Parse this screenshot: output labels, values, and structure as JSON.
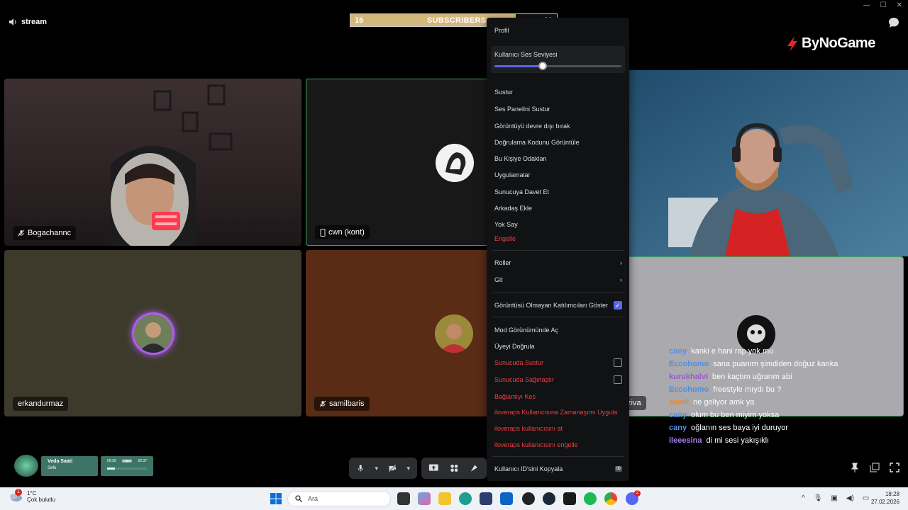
{
  "window": {
    "controls": [
      "—",
      "☐",
      "✕"
    ],
    "title": "stream"
  },
  "subscriber_bar": {
    "current": "16",
    "label": "SUBSCRIBERS",
    "goal": "20",
    "progress_fraction": 0.8
  },
  "logo": {
    "text": "ByNoGame"
  },
  "tiles": [
    {
      "name": "Bogachannc",
      "icon": "mic-muted-icon"
    },
    {
      "name": "cwn (kont)",
      "icon": "phone-icon"
    },
    {
      "name": "erkandurmaz",
      "icon": ""
    },
    {
      "name": "samilbaris",
      "icon": "mic-muted-icon"
    },
    {
      "name": "ziva",
      "icon": ""
    }
  ],
  "context_menu": {
    "profile": "Profil",
    "volume_label": "Kullanıcı Ses Seviyesi",
    "volume_fraction": 0.38,
    "items": [
      "Sustur",
      "Ses Panelini Sustur",
      "Görüntüyü devre dışı bırak",
      "Doğrulama Kodunu Görüntüle",
      "Bu Kişiye Odaklan",
      "Uygulamalar",
      "Sunucuya Davet Et",
      "Arkadaş Ekle",
      "Yok Say"
    ],
    "block": "Engelle",
    "roles": "Roller",
    "go": "Git",
    "show_no_video": "Görüntüsü Olmayan Katılımcıları Göster",
    "mod_view": "Mod Görünümünde Aç",
    "verify": "Üyeyi Doğrula",
    "server_mute": "Sunucuda Sustur",
    "server_deafen": "Sunucuda Sağırlaştır",
    "disconnect": "Bağlantıyı Kes",
    "timeout": "iloveraps Kullanıcısına Zamanaşımı Uygula",
    "kick": "iloveraps kullanıcısını at",
    "ban": "iloveraps kullanıcısını engelle",
    "copy_id": "Kullanıcı ID'sini Kopyala",
    "id_badge": "ID"
  },
  "chat": [
    {
      "user": "cany",
      "color": "#5b8ee0",
      "text": "kanki e hani rap yok mu"
    },
    {
      "user": "Eccohomo",
      "color": "#4d8fe0",
      "text": "sana puanım şimdiden doğuz kanka"
    },
    {
      "user": "kurukhalvi",
      "color": "#9b59d0",
      "text": "ben kaçtım uğrarım abi"
    },
    {
      "user": "Eccohomo",
      "color": "#4d8fe0",
      "text": "freestyle mıydı bu ?"
    },
    {
      "user": "samil",
      "color": "#e08a3a",
      "text": "ne geliyor amk ya"
    },
    {
      "user": "cany",
      "color": "#5b8ee0",
      "text": "olum bu ben miyim yoksa"
    },
    {
      "user": "cany",
      "color": "#5b8ee0",
      "text": "oğlanın ses baya iyi duruyor"
    },
    {
      "user": "ileeesina",
      "color": "#a77bf0",
      "text": "di mi sesi yakışıklı"
    }
  ],
  "now_playing": {
    "title": "Veda Saati",
    "artist": "Sefo",
    "elapsed": "00:30",
    "duration": "02:37",
    "progress_fraction": 0.19
  },
  "taskbar": {
    "temperature": "1°C",
    "weather": "Çok bulutlu",
    "weather_badge": "1",
    "search_placeholder": "Ara",
    "time": "18:28",
    "date": "27.02.2026",
    "discord_badge": "2"
  },
  "colors": {
    "accent": "#5865f2",
    "danger": "#f23f43",
    "menu_bg": "#111214",
    "sub_fill": "#d4b77a"
  }
}
